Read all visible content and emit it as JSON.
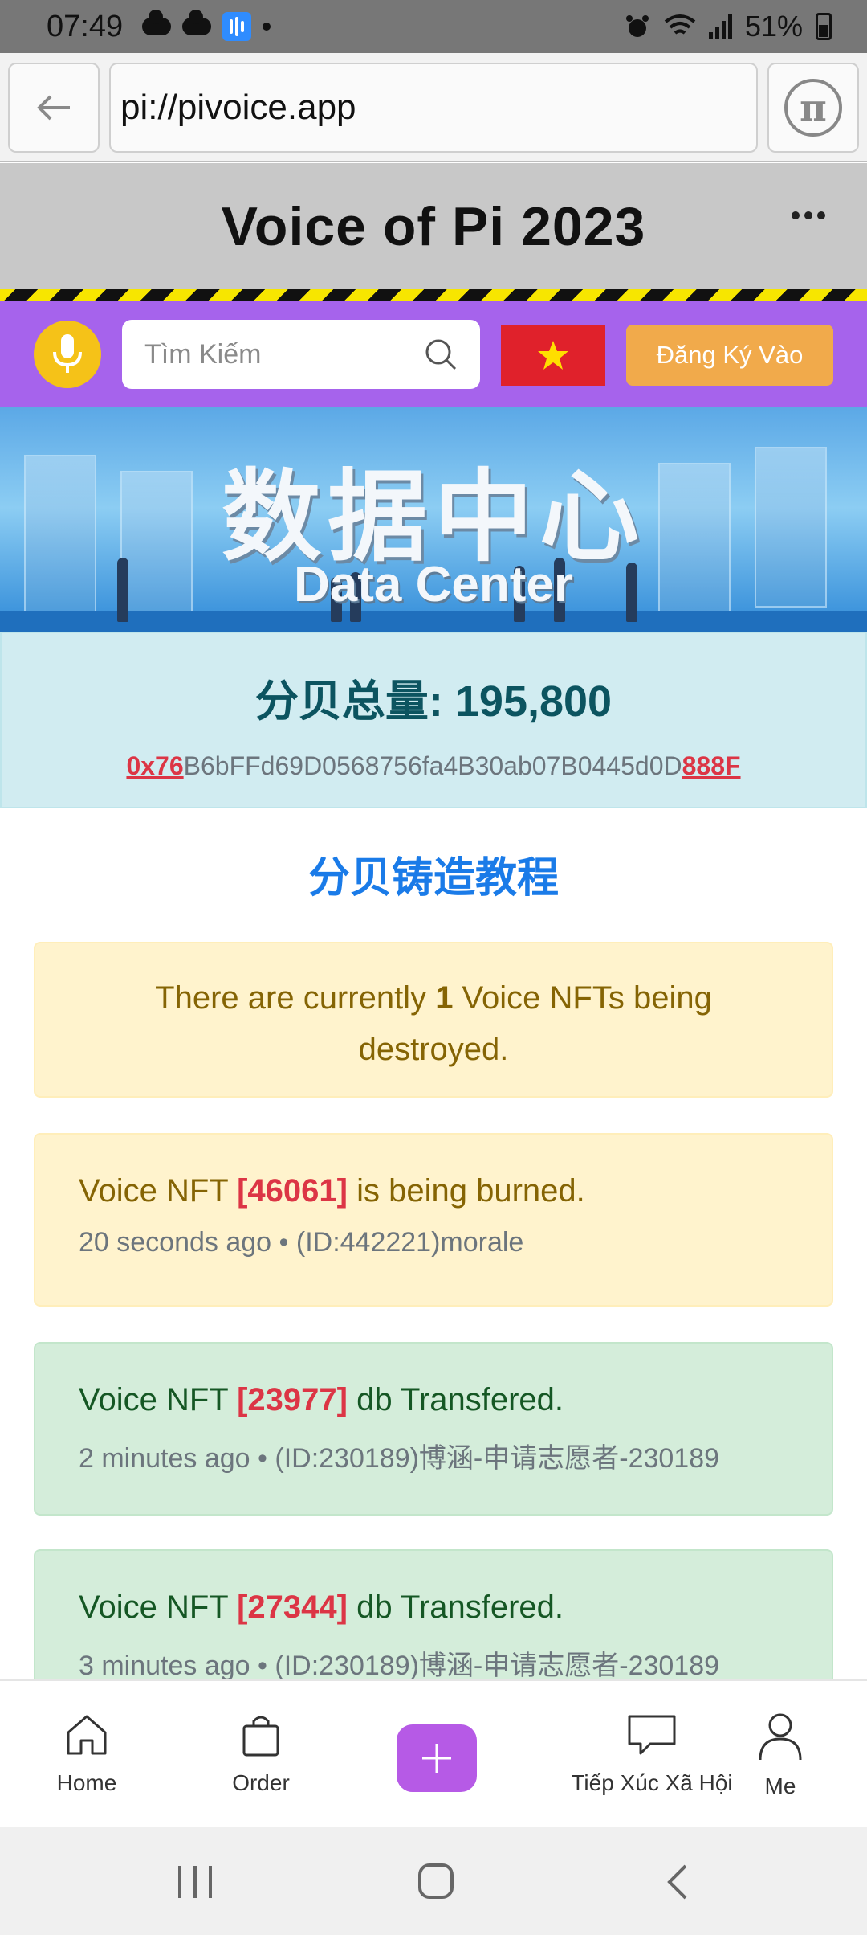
{
  "status_bar": {
    "time": "07:49",
    "battery": "51%"
  },
  "browser": {
    "url": "pi://pivoice.app",
    "icons": {
      "back": "arrow-left-icon",
      "pi": "pi-logo-icon"
    }
  },
  "header": {
    "title": "Voice of Pi 2023",
    "menu_icon": "more-horizontal-icon"
  },
  "search_row": {
    "search_placeholder": "Tìm Kiếm",
    "register_label": "Đăng Ký Vào",
    "flag": "vietnam-flag",
    "colors": {
      "bar": "#a663ec",
      "mic": "#f5c218",
      "register": "#f1aa4b"
    }
  },
  "banner": {
    "title_cn": "数据中心",
    "title_en": "Data Center"
  },
  "data_center": {
    "total_label": "分贝总量: 195,800",
    "address_prefix": "0x76",
    "address_middle": "B6bFFd69D0568756fa4B30ab07B0445d0D",
    "address_suffix": "888F"
  },
  "tutorial_link": "分贝铸造教程",
  "notice": {
    "before": "There are currently ",
    "count": "1",
    "after": " Voice NFTs being destroyed."
  },
  "events": [
    {
      "prefix": "Voice NFT ",
      "nft_id": "[46061]",
      "action": " is being burned.",
      "meta": "20 seconds ago • (ID:442221)morale",
      "status": "warn"
    },
    {
      "prefix": "Voice NFT ",
      "nft_id": "[23977]",
      "action": " db Transfered.",
      "meta": "2 minutes ago • (ID:230189)博涵-申请志愿者-230189",
      "status": "ok"
    },
    {
      "prefix": "Voice NFT ",
      "nft_id": "[27344]",
      "action": " db Transfered.",
      "meta": "3 minutes ago • (ID:230189)博涵-申请志愿者-230189",
      "status": "ok"
    }
  ],
  "bottom_nav": {
    "home": "Home",
    "order": "Order",
    "social": "Tiếp Xúc Xã Hội",
    "me": "Me"
  }
}
